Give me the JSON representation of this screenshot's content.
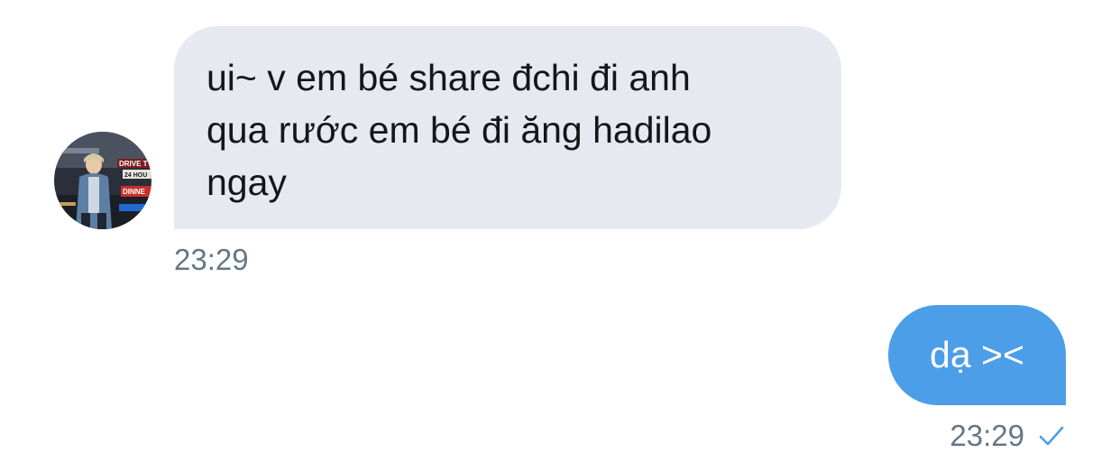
{
  "conversation": {
    "incoming": {
      "lines": [
        "ui~ v em bé share đchi đi anh",
        "qua rước em bé đi ăng hadilao",
        "ngay"
      ],
      "time": "23:29",
      "avatar_sign": {
        "line1": "DRIVE T",
        "line2": "24 HOU",
        "line3": "DINNE"
      }
    },
    "outgoing": {
      "text": "dạ ><",
      "time": "23:29",
      "status_icon": "check-icon"
    }
  },
  "colors": {
    "incoming_bubble": "#e6e9f0",
    "outgoing_bubble": "#4c9ee8",
    "timestamp": "#657786",
    "check": "#4c9ee8"
  }
}
